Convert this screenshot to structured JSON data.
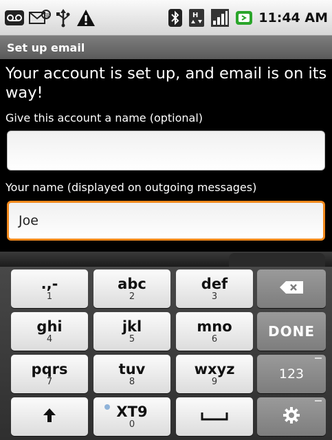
{
  "statusbar": {
    "time": "11:44 AM",
    "left_icons": [
      "voicemail-icon",
      "email-notification-icon",
      "usb-icon",
      "warning-icon"
    ],
    "right_icons": [
      "bluetooth-icon",
      "hspa-data-icon",
      "signal-icon",
      "battery-icon"
    ]
  },
  "titlebar": {
    "title": "Set up email"
  },
  "content": {
    "heading": "Your account is set up, and email is on its way!",
    "account_name_label": "Give this account a name (optional)",
    "account_name_value": "",
    "your_name_label": "Your name (displayed on outgoing messages)",
    "your_name_value": "Joe"
  },
  "keyboard": {
    "rows": [
      [
        {
          "main": ".,-",
          "sub": "1"
        },
        {
          "main": "abc",
          "sub": "2"
        },
        {
          "main": "def",
          "sub": "3"
        },
        {
          "main": "",
          "sub": "",
          "icon": "backspace-icon"
        }
      ],
      [
        {
          "main": "ghi",
          "sub": "4"
        },
        {
          "main": "jkl",
          "sub": "5"
        },
        {
          "main": "mno",
          "sub": "6"
        },
        {
          "main": "DONE",
          "sub": ""
        }
      ],
      [
        {
          "main": "pqrs",
          "sub": "7"
        },
        {
          "main": "tuv",
          "sub": "8"
        },
        {
          "main": "wxyz",
          "sub": "9"
        },
        {
          "main": "123",
          "sub": ""
        }
      ],
      [
        {
          "main": "",
          "sub": "",
          "icon": "shift-arrow-icon"
        },
        {
          "main": "XT9",
          "sub": "0"
        },
        {
          "main": "",
          "sub": "",
          "icon": "space-bar-icon"
        },
        {
          "main": "",
          "sub": "",
          "icon": "settings-gear-icon"
        }
      ]
    ],
    "done_label": "DONE",
    "numbers_label": "123"
  },
  "colors": {
    "focus": "#f2891c",
    "background": "#000000"
  }
}
